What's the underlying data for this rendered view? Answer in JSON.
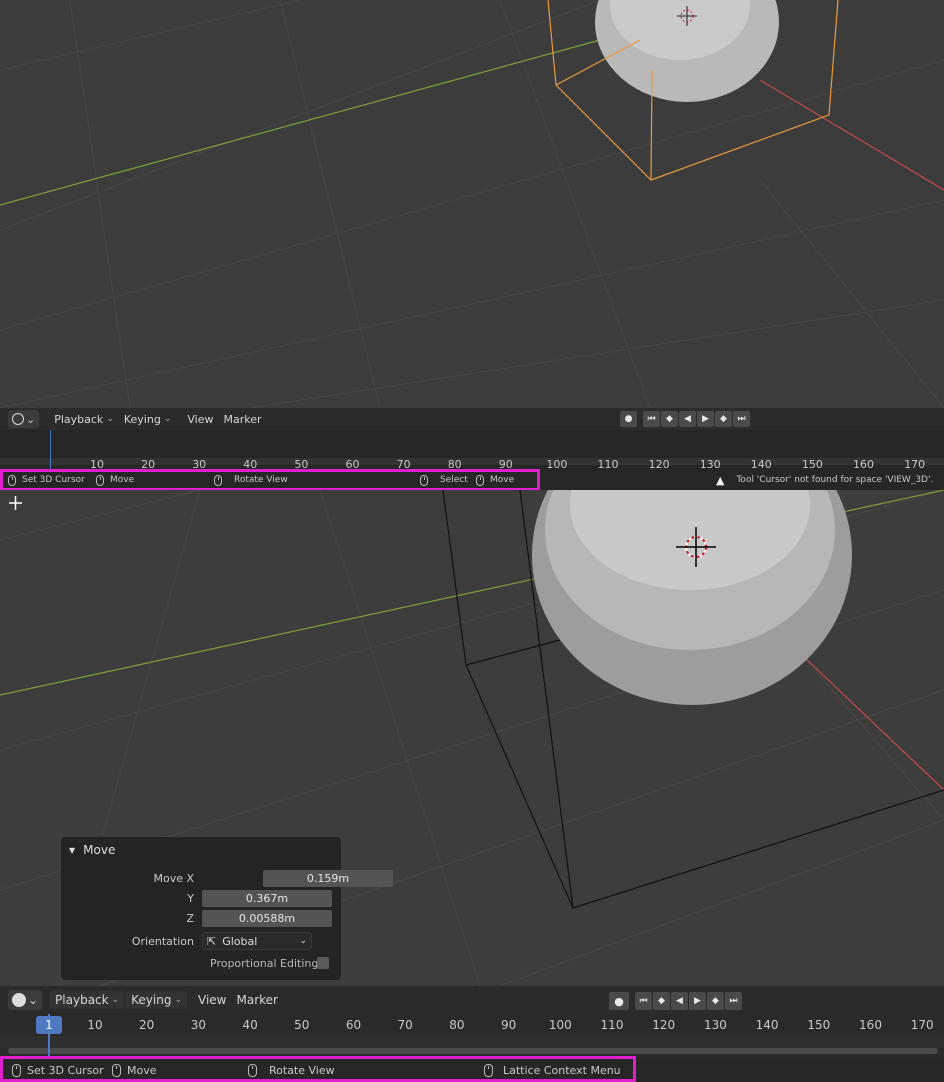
{
  "colors": {
    "highlight": "#e21fcf",
    "x_axis": "#c24a4a",
    "y_axis": "#7ea035",
    "frame_marker": "#4f79c2",
    "bbox_orange": "#e89a3c"
  },
  "top_timeline": {
    "menus": [
      "Playback",
      "Keying",
      "View",
      "Marker"
    ],
    "current_frame": "1",
    "ticks": [
      "10",
      "20",
      "30",
      "40",
      "50",
      "60",
      "70",
      "80",
      "90",
      "100",
      "110",
      "120",
      "130",
      "140",
      "150",
      "160",
      "170"
    ]
  },
  "top_status": {
    "items": [
      "Set 3D Cursor",
      "Move",
      "Rotate View",
      "Select",
      "Move"
    ],
    "warning": "Tool 'Cursor' not found for space 'VIEW_3D'."
  },
  "move_panel": {
    "title": "Move",
    "move_x_label": "Move X",
    "move_x": "0.159m",
    "y_label": "Y",
    "y": "0.367m",
    "z_label": "Z",
    "z": "0.00588m",
    "orientation_label": "Orientation",
    "orientation": "Global",
    "proportional_label": "Proportional Editing"
  },
  "bottom_timeline": {
    "menus": [
      "Playback",
      "Keying",
      "View",
      "Marker"
    ],
    "current_frame": "1",
    "ticks": [
      "10",
      "20",
      "30",
      "40",
      "50",
      "60",
      "70",
      "80",
      "90",
      "100",
      "110",
      "120",
      "130",
      "140",
      "150",
      "160",
      "170"
    ]
  },
  "bottom_status": {
    "items": [
      "Set 3D Cursor",
      "Move",
      "Rotate View",
      "Lattice Context Menu"
    ]
  }
}
